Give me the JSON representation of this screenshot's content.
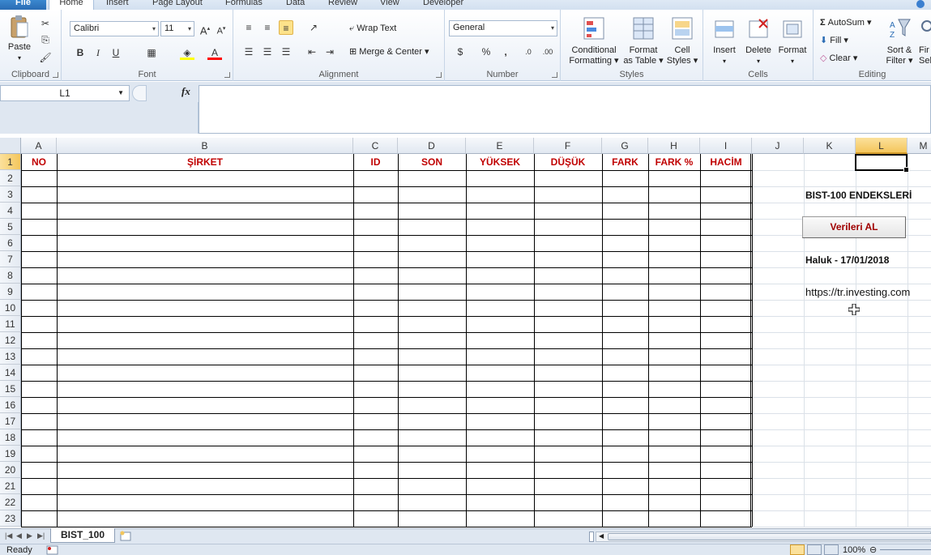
{
  "ribbon_tabs": [
    "File",
    "Home",
    "Insert",
    "Page Layout",
    "Formulas",
    "Data",
    "Review",
    "View",
    "Developer"
  ],
  "clipboard": {
    "paste": "Paste",
    "label": "Clipboard"
  },
  "font": {
    "name": "Calibri",
    "size": "11",
    "label": "Font",
    "bold": "B",
    "italic": "I",
    "underline": "U",
    "grow": "A",
    "shrink": "A"
  },
  "alignment": {
    "wrap_text": "Wrap Text",
    "merge_center": "Merge & Center",
    "label": "Alignment"
  },
  "number": {
    "format": "General",
    "percent": "%",
    "comma": ",",
    "label": "Number"
  },
  "styles": {
    "conditional_1": "Conditional",
    "conditional_2": "Formatting",
    "format_table_1": "Format",
    "format_table_2": "as Table",
    "cell_styles_1": "Cell",
    "cell_styles_2": "Styles",
    "label": "Styles"
  },
  "cells": {
    "insert": "Insert",
    "delete": "Delete",
    "format": "Format",
    "label": "Cells"
  },
  "editing": {
    "autosum": "AutoSum",
    "fill": "Fill",
    "clear": "Clear",
    "sort_1": "Sort &",
    "sort_2": "Filter",
    "find_1": "Fir",
    "find_2": "Sel",
    "label": "Editing"
  },
  "formula_bar": {
    "name_box": "L1",
    "fx": "fx",
    "formula": ""
  },
  "columns": [
    "A",
    "B",
    "C",
    "D",
    "E",
    "F",
    "G",
    "H",
    "I",
    "J",
    "K",
    "L",
    "M"
  ],
  "rows": [
    "1",
    "2",
    "3",
    "4",
    "5",
    "6",
    "7",
    "8",
    "9",
    "10",
    "11",
    "12",
    "13",
    "14",
    "15",
    "16",
    "17",
    "18",
    "19",
    "20",
    "21",
    "22",
    "23"
  ],
  "table_headers": [
    "NO",
    "ŞİRKET",
    "ID",
    "SON",
    "YÜKSEK",
    "DÜŞÜK",
    "FARK",
    "FARK %",
    "HACİM"
  ],
  "side_panel": {
    "title": "BIST-100 ENDEKSLERİ",
    "button": "Verileri AL",
    "author": "Haluk - 17/01/2018",
    "source": "https://tr.investing.com"
  },
  "sheets": {
    "active": "BIST_100"
  },
  "status": {
    "ready": "Ready",
    "zoom": "100%"
  },
  "colors": {
    "header_red": "#c00000",
    "selection_orange": "#f4c65c"
  }
}
